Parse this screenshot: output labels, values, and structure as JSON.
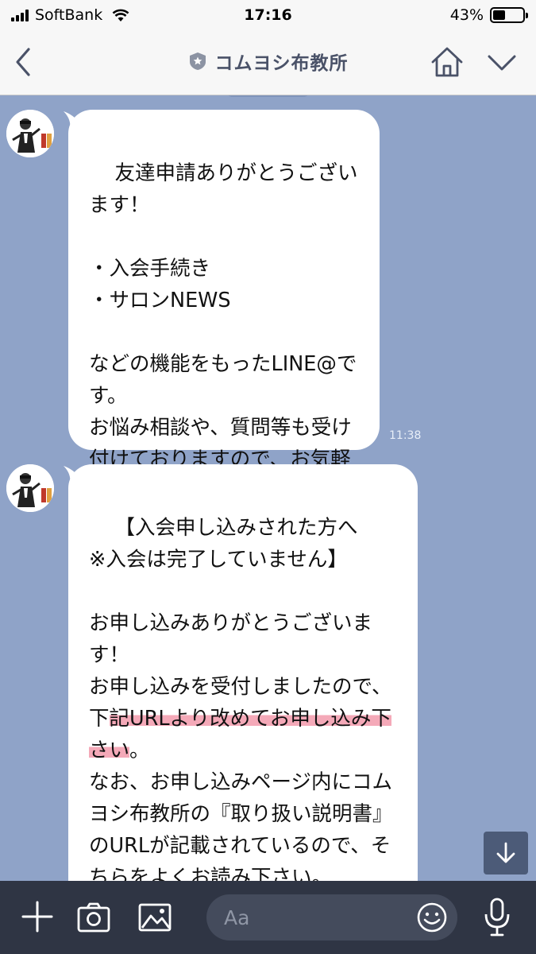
{
  "status_bar": {
    "carrier": "SoftBank",
    "time": "17:16",
    "battery_percent": "43%",
    "battery_level": 0.43
  },
  "header": {
    "title": "コムヨシ布教所"
  },
  "messages": [
    {
      "sender": "コムヨシ布教所",
      "text": "友達申請ありがとうございます！\n\n・入会手続き\n・サロンNEWS\n\nなどの機能をもったLINE@です。\nお悩み相談や、質問等も受け付けておりますので、お気軽にご利用下さい。",
      "time": "11:38"
    },
    {
      "sender": "コムヨシ布教所",
      "text_before_highlight": "【入会申し込みされた方へ\n※入会は完了していません】\n\nお申し込みありがとうございます！\nお申し込みを受付しましたので、下",
      "text_highlight": "記URLより改めてお申し込み下さい",
      "text_after_highlight": "。\nなお、お申し込みページ内にコムヨシ布教所の『取り扱い説明書』のURLが記載されているので、そちらをよくお読み下さい。"
    }
  ],
  "composer": {
    "placeholder": "Aa"
  },
  "icons": {
    "back": "chevron-left-icon",
    "official_badge": "star-badge-icon",
    "home": "home-icon",
    "menu": "chevron-down-icon",
    "scroll_down": "arrow-down-icon",
    "add": "plus-icon",
    "camera": "camera-icon",
    "image": "image-icon",
    "emoji": "smiley-icon",
    "mic": "microphone-icon"
  },
  "colors": {
    "chat_background": "#8fa3c8",
    "header_title": "#4a5268",
    "toolbar_background": "#2f3544",
    "highlight": "#f08ca0"
  }
}
